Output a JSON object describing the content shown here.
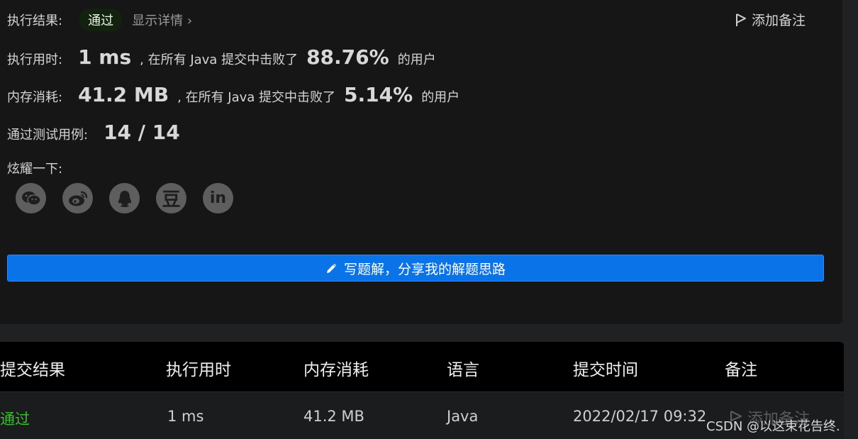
{
  "result": {
    "label": "执行结果:",
    "status": "通过",
    "details": "显示详情",
    "add_note": "添加备注"
  },
  "runtime": {
    "label": "执行用时:",
    "value": "1 ms",
    "mid": ", 在所有 Java 提交中击败了",
    "percent": "88.76%",
    "suffix": "的用户"
  },
  "memory": {
    "label": "内存消耗:",
    "value": "41.2 MB",
    "mid": ", 在所有 Java 提交中击败了",
    "percent": "5.14%",
    "suffix": "的用户"
  },
  "testcases": {
    "label": "通过测试用例:",
    "value": "14 / 14"
  },
  "share": {
    "label": "炫耀一下:",
    "douban_glyph": "豆",
    "linkedin_glyph": "in"
  },
  "solution_button": "写题解，分享我的解题思路",
  "table": {
    "headers": [
      "提交结果",
      "执行用时",
      "内存消耗",
      "语言",
      "提交时间",
      "备注"
    ],
    "row": {
      "status": "通过",
      "runtime": "1 ms",
      "memory": "41.2 MB",
      "language": "Java",
      "time": "2022/02/17 09:32",
      "note": "添加备注"
    }
  },
  "watermark": "CSDN @以这束花告终.",
  "colors": {
    "accent_blue": "#0a73e8",
    "pass_green": "#3bbf2f",
    "panel_bg": "#161616"
  }
}
